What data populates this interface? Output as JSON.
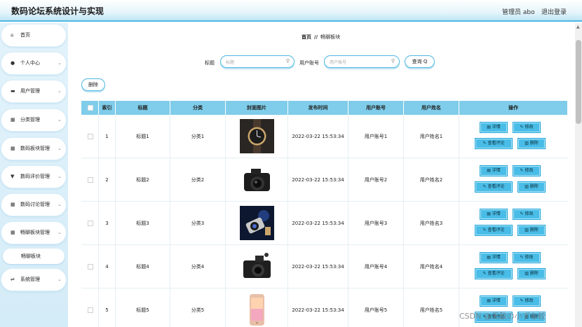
{
  "header": {
    "title": "数码论坛系统设计与实现",
    "admin": "管理员 abo",
    "logout": "退出登录"
  },
  "sidebar": {
    "items": [
      {
        "label": "首页",
        "icon": "home-icon",
        "glyph": "⌂",
        "chevron": false
      },
      {
        "label": "个人中心",
        "icon": "user-icon",
        "glyph": "●",
        "chevron": true
      },
      {
        "label": "用户管理",
        "icon": "briefcase-icon",
        "glyph": "▬",
        "chevron": true
      },
      {
        "label": "分类管理",
        "icon": "grid-icon",
        "glyph": "▦",
        "chevron": true
      },
      {
        "label": "数码板块管理",
        "icon": "grid-icon",
        "glyph": "▦",
        "chevron": true
      },
      {
        "label": "数码评价管理",
        "icon": "cup-icon",
        "glyph": "▼",
        "chevron": true
      },
      {
        "label": "数码讨论管理",
        "icon": "grid-icon",
        "glyph": "▦",
        "chevron": true
      },
      {
        "label": "畅聊板块管理",
        "icon": "grid-icon",
        "glyph": "▦",
        "chevron": true
      },
      {
        "label": "系统管理",
        "icon": "sliders-icon",
        "glyph": "⇌",
        "chevron": true
      }
    ],
    "sub_item": "畅聊板块",
    "chevron_glyph": "⌄"
  },
  "breadcrumb": {
    "home": "首页",
    "separator": "//",
    "current": "畅聊板块"
  },
  "search": {
    "title_label": "标题",
    "title_placeholder": "标题",
    "account_label": "用户账号",
    "account_placeholder": "用户账号",
    "query_button": "查询 Q"
  },
  "toolbar": {
    "delete_button": "删除"
  },
  "table": {
    "columns": [
      "",
      "索引",
      "标题",
      "分类",
      "封面图片",
      "发布时间",
      "用户账号",
      "用户姓名",
      "操作"
    ],
    "rows": [
      {
        "index": "1",
        "title": "标题1",
        "category": "分类1",
        "image": "watch",
        "time": "2022-03-22 15:53:34",
        "account": "用户账号1",
        "name": "用户姓名1"
      },
      {
        "index": "2",
        "title": "标题2",
        "category": "分类2",
        "image": "camera",
        "time": "2022-03-22 15:53:34",
        "account": "用户账号2",
        "name": "用户姓名2"
      },
      {
        "index": "3",
        "title": "标题3",
        "category": "分类3",
        "image": "lens",
        "time": "2022-03-22 15:53:34",
        "account": "用户账号3",
        "name": "用户姓名3"
      },
      {
        "index": "4",
        "title": "标题4",
        "category": "分类4",
        "image": "compact-camera",
        "time": "2022-03-22 15:53:34",
        "account": "用户账号4",
        "name": "用户姓名4"
      },
      {
        "index": "5",
        "title": "标题5",
        "category": "分类5",
        "image": "phone",
        "time": "2022-03-22 15:53:34",
        "account": "用户账号5",
        "name": "用户姓名5"
      }
    ],
    "actions": {
      "detail": "▤ 详情",
      "edit": "✎ 修改",
      "comments": "✎ 查看评论",
      "delete": "▥ 删除"
    }
  },
  "watermark": "CSDN @无敌の小ずな蛟",
  "colors": {
    "accent": "#4fb8e3",
    "table_header": "#7fcdea",
    "action_button": "#49bde7"
  }
}
